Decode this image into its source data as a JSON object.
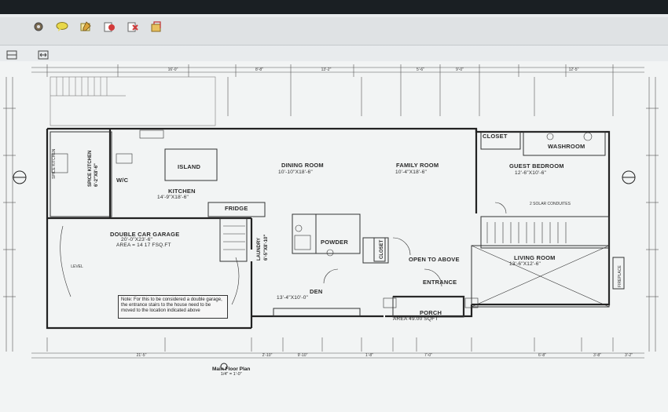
{
  "rooms": {
    "dining": {
      "name": "DINING ROOM",
      "dim": "10'-10\"X18'-6\""
    },
    "family": {
      "name": "FAMILY ROOM",
      "dim": "10'-4\"X18'-6\""
    },
    "guest": {
      "name": "GUEST BEDROOM",
      "dim": "12'-6\"X10'-6\""
    },
    "kitchen": {
      "name": "KITCHEN",
      "dim": "14'-9\"X18'-6\""
    },
    "island": {
      "name": "ISLAND"
    },
    "wc": {
      "name": "W/C"
    },
    "fridge": {
      "name": "FRIDGE"
    },
    "garage": {
      "name": "DOUBLE CAR GARAGE",
      "dim": "20'-0\"X23'-6\"",
      "area": "AREA = 14 17 FSQ.FT"
    },
    "den": {
      "name": "DEN",
      "dim": "13'-4\"X10'-0\""
    },
    "living": {
      "name": "LIVING ROOM",
      "dim": "13'-6\"X12'-6\""
    },
    "closet_top": {
      "name": "CLOSET"
    },
    "washroom": {
      "name": "WASHROOM"
    },
    "powder": {
      "name": "POWDER"
    },
    "laundry": {
      "name": "LAUNDRY",
      "dim": "6'-5\"X8'-10\""
    },
    "closet_mid": {
      "name": "CLOSET"
    },
    "open_above": {
      "name": "OPEN TO ABOVE"
    },
    "entrance": {
      "name": "ENTRANCE"
    },
    "porch": {
      "name": "PORCH",
      "area": "AREA 49.00 SQFT"
    },
    "spice": {
      "name": "SPICE KITCHEN",
      "dim": "6'-2\"X8'-6\""
    }
  },
  "note": "Note: For this to be considered a double garage, the entrance stairs to the house need to be moved to the location indicated above",
  "title": {
    "name": "Main Floor Plan",
    "scale": "1/4\" = 1'-0\""
  },
  "dims_bottom": [
    "21'-5\"",
    "2'-10\"",
    "9'-10\"",
    "1'-8\"",
    "7'-0\"",
    "6'-8\"",
    "3'-8\"",
    "3'-2\""
  ],
  "dims_top": [
    "16'-0\"",
    "8'-8\"",
    "13'-2\"",
    "5'-6\"",
    "9'-0\"",
    "12'-5\""
  ],
  "misc": {
    "solar": "2 SOLAR CONDUITES",
    "level": "LEVEL",
    "vtext_kitchen": "SPICE KITCHEN",
    "vtext_fireplace": "FIREPLACE"
  },
  "toolbar_icons": [
    "settings-icon",
    "comment-icon",
    "edit-icon",
    "stamp-icon",
    "delete-icon",
    "share-icon"
  ]
}
